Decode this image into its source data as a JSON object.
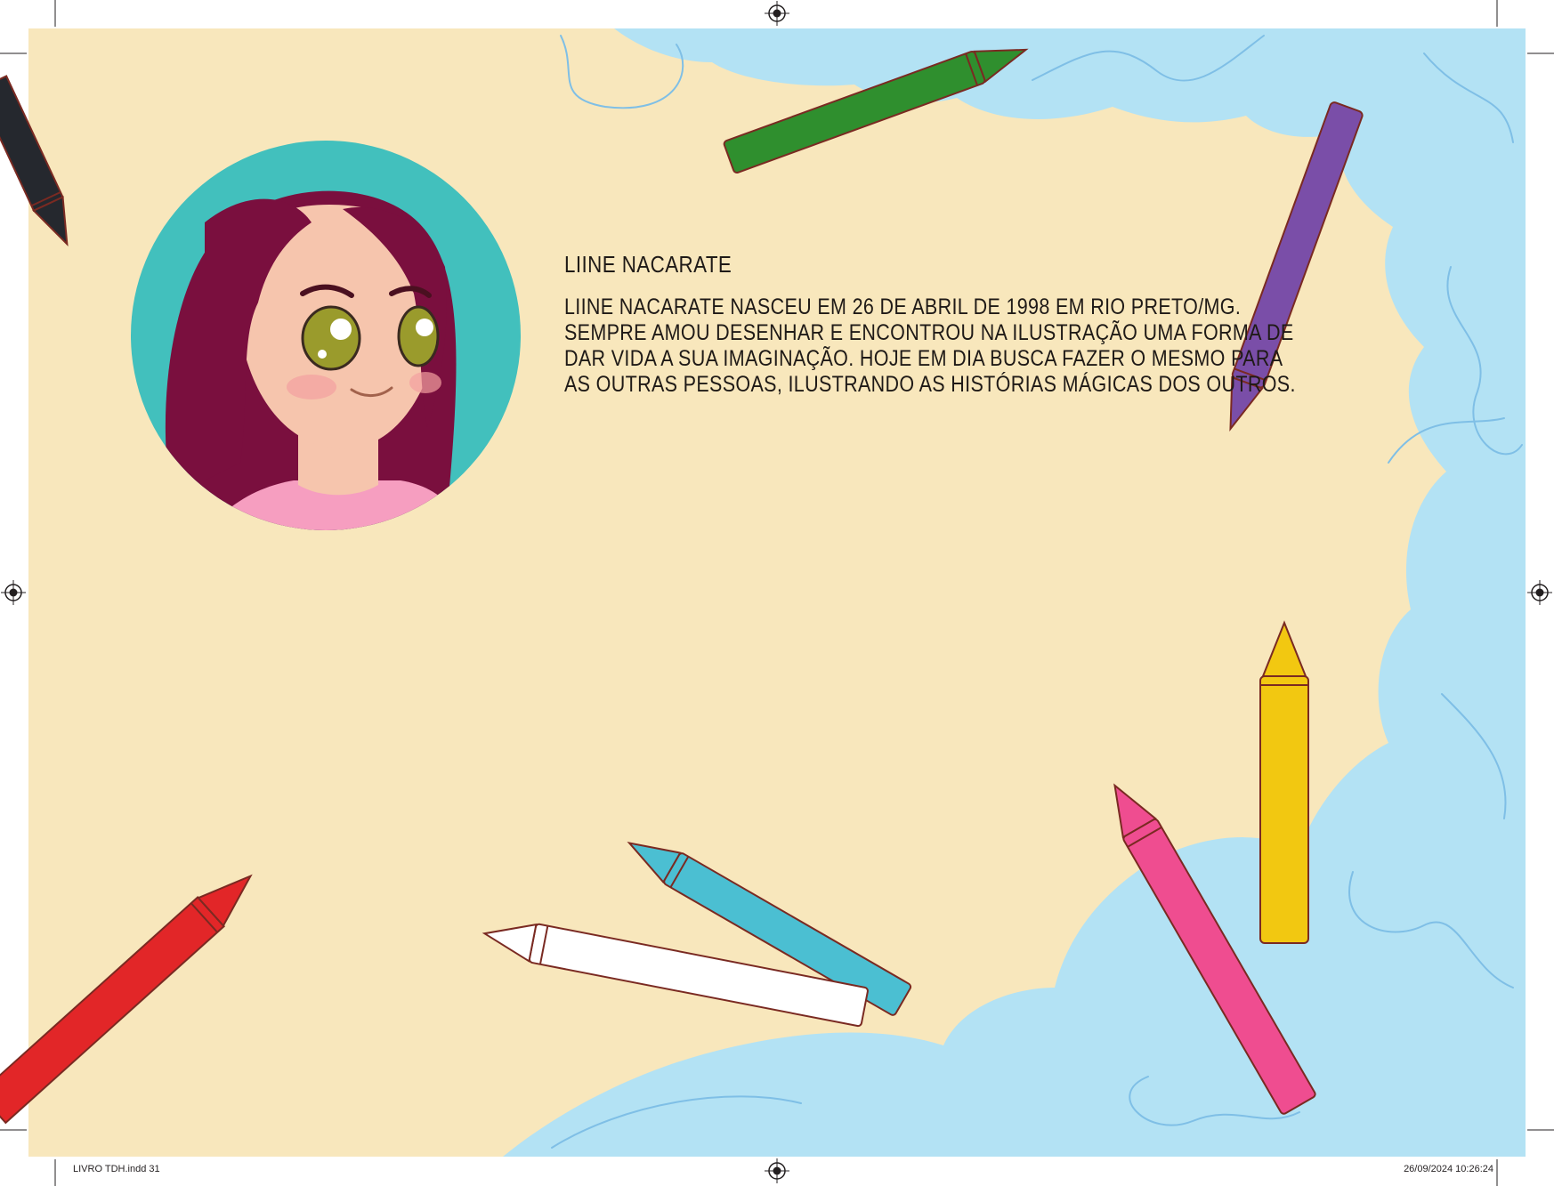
{
  "page": {
    "background_color": "#f8e7bc",
    "sky_color": "#b3e2f4"
  },
  "bio": {
    "name": "LIINE NACARATE",
    "lines": [
      "LIINE NACARATE NASCEU EM 26 DE ABRIL DE 1998 EM RIO PRETO/MG.",
      "SEMPRE AMOU DESENHAR E ENCONTROU NA ILUSTRAÇÃO UMA FORMA DE",
      "DAR VIDA A SUA IMAGINAÇÃO. HOJE EM DIA BUSCA FAZER O MESMO PARA",
      "AS OUTRAS PESSOAS, ILUSTRANDO AS HISTÓRIAS MÁGICAS DOS OUTROS."
    ]
  },
  "crayons": [
    {
      "color_name": "black",
      "color": "#25282e"
    },
    {
      "color_name": "green",
      "color": "#2f8f2e"
    },
    {
      "color_name": "purple",
      "color": "#7a4ea8"
    },
    {
      "color_name": "red",
      "color": "#e22628"
    },
    {
      "color_name": "blue",
      "color": "#4bbfd2"
    },
    {
      "color_name": "white",
      "color": "#ffffff"
    },
    {
      "color_name": "yellow",
      "color": "#f2c811"
    },
    {
      "color_name": "pink",
      "color": "#ef4d90"
    }
  ],
  "portrait": {
    "circle_color": "#42c0bd",
    "hair_color": "#7a0f3e",
    "skin_color": "#f6c5ad",
    "eye_color": "#9a9b2c"
  },
  "slug": {
    "file": "LIVRO TDH.indd   31",
    "timestamp": "26/09/2024   10:26:24"
  }
}
